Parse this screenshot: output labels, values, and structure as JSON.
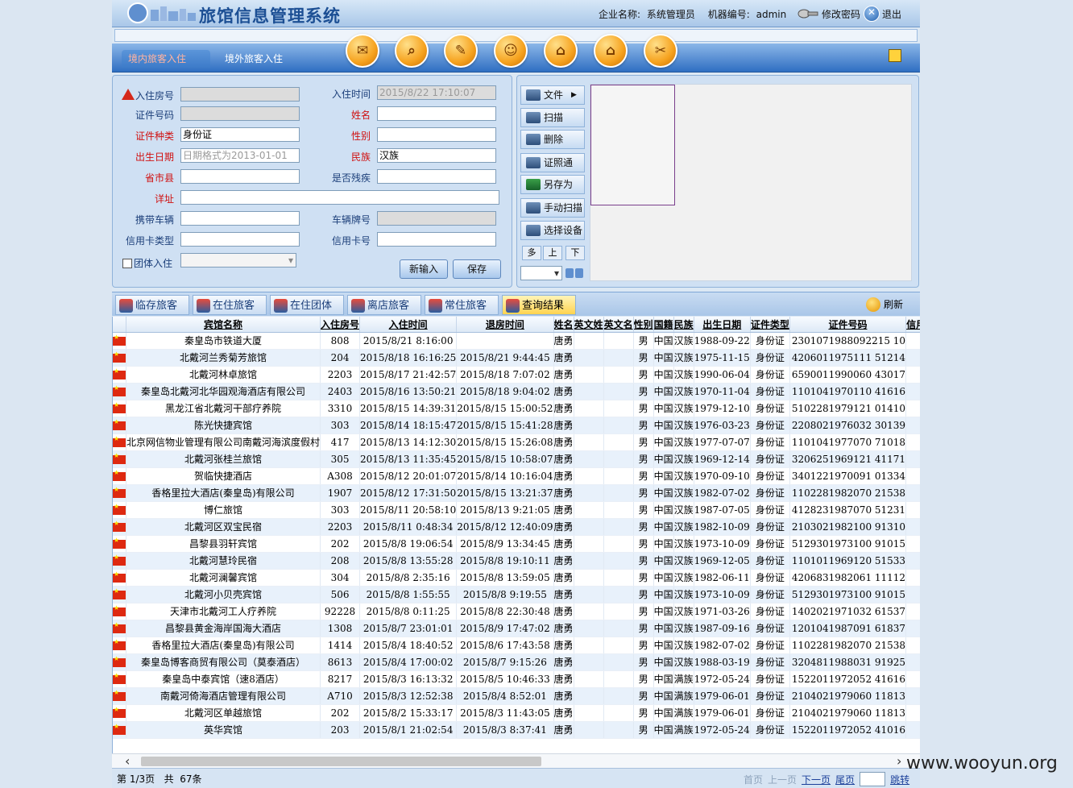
{
  "header": {
    "title": "旅馆信息管理系统",
    "company_label": "企业名称:",
    "company_value": "系统管理员",
    "machine_label": "机器编号:",
    "machine_value": "admin",
    "change_password": "修改密码",
    "logout": "退出"
  },
  "nav": {
    "tabs": [
      {
        "label": "境内旅客入住",
        "active": true
      },
      {
        "label": "境外旅客入住",
        "active": false
      }
    ],
    "icons": [
      "mail-icon",
      "search-doc-icon",
      "clean-icon",
      "user-icon",
      "home-icon",
      "house-settings-icon",
      "tools-icon"
    ]
  },
  "form": {
    "room_no": {
      "label": "入住房号",
      "value": ""
    },
    "checkin_time": {
      "label": "入住时间",
      "value": "2015/8/22 17:10:07"
    },
    "id_no": {
      "label": "证件号码",
      "value": ""
    },
    "name": {
      "label": "姓名",
      "value": ""
    },
    "id_type": {
      "label": "证件种类",
      "value": "身份证"
    },
    "gender": {
      "label": "性别",
      "value": ""
    },
    "birth": {
      "label": "出生日期",
      "placeholder": "日期格式为2013-01-01"
    },
    "ethnicity": {
      "label": "民族",
      "value": "汉族"
    },
    "province": {
      "label": "省市县",
      "value": ""
    },
    "disabled": {
      "label": "是否残疾",
      "value": ""
    },
    "address": {
      "label": "详址",
      "value": ""
    },
    "vehicle": {
      "label": "携带车辆",
      "value": ""
    },
    "plate": {
      "label": "车辆牌号",
      "value": ""
    },
    "card_type": {
      "label": "信用卡类型",
      "value": ""
    },
    "card_no": {
      "label": "信用卡号",
      "value": ""
    },
    "group": {
      "label": "团体入住"
    },
    "btn_new": "新输入",
    "btn_save": "保存"
  },
  "side": {
    "buttons": [
      "文件",
      "扫描",
      "删除",
      "证照通",
      "另存为",
      "手动扫描",
      "选择设备"
    ],
    "tabs": [
      "多",
      "上",
      "下"
    ]
  },
  "tabs": {
    "items": [
      "临存旅客",
      "在住旅客",
      "在住团体",
      "离店旅客",
      "常住旅客",
      "查询结果"
    ],
    "active": "查询结果",
    "refresh": "刷新"
  },
  "grid": {
    "columns": [
      "宾馆名称",
      "入住房号",
      "入住时间",
      "退房时间",
      "姓名",
      "英文姓",
      "英文名",
      "性别",
      "国籍",
      "民族",
      "出生日期",
      "证件类型",
      "证件号码",
      "信用卡类"
    ],
    "rows": [
      [
        "秦皇岛市铁道大厦",
        "808",
        "2015/8/21 8:16:00",
        "",
        "唐勇",
        "",
        "",
        "男",
        "中国",
        "汉族",
        "1988-09-22",
        "身份证",
        "2301071988092215 10"
      ],
      [
        "北戴河兰秀菊芳旅馆",
        "204",
        "2015/8/18 16:16:25",
        "2015/8/21 9:44:45",
        "唐勇",
        "",
        "",
        "男",
        "中国",
        "汉族",
        "1975-11-15",
        "身份证",
        "4206011975111 51214"
      ],
      [
        "北戴河林卓旅馆",
        "2203",
        "2015/8/17 21:42:57",
        "2015/8/18 7:07:02",
        "唐勇",
        "",
        "",
        "男",
        "中国",
        "汉族",
        "1990-06-04",
        "身份证",
        "6590011990060 43017"
      ],
      [
        "秦皇岛北戴河北华园观海酒店有限公司",
        "2403",
        "2015/8/16 13:50:21",
        "2015/8/18 9:04:02",
        "唐勇",
        "",
        "",
        "男",
        "中国",
        "汉族",
        "1970-11-04",
        "身份证",
        "1101041970110 41616"
      ],
      [
        "黑龙江省北戴河干部疗养院",
        "3310",
        "2015/8/15 14:39:31",
        "2015/8/15 15:00:52",
        "唐勇",
        "",
        "",
        "男",
        "中国",
        "汉族",
        "1979-12-10",
        "身份证",
        "5102281979121 01410"
      ],
      [
        "陈光快捷宾馆",
        "303",
        "2015/8/14 18:15:47",
        "2015/8/15 15:41:28",
        "唐勇",
        "",
        "",
        "男",
        "中国",
        "汉族",
        "1976-03-23",
        "身份证",
        "2208021976032 30139"
      ],
      [
        "北京网信物业管理有限公司南戴河海滨度假村",
        "417",
        "2015/8/13 14:12:30",
        "2015/8/15 15:26:08",
        "唐勇",
        "",
        "",
        "男",
        "中国",
        "汉族",
        "1977-07-07",
        "身份证",
        "1101041977070 71018"
      ],
      [
        "北戴河张桂兰旅馆",
        "305",
        "2015/8/13 11:35:45",
        "2015/8/15 10:58:07",
        "唐勇",
        "",
        "",
        "男",
        "中国",
        "汉族",
        "1969-12-14",
        "身份证",
        "3206251969121 41171"
      ],
      [
        "贺临快捷酒店",
        "A308",
        "2015/8/12 20:01:07",
        "2015/8/14 10:16:04",
        "唐勇",
        "",
        "",
        "男",
        "中国",
        "汉族",
        "1970-09-10",
        "身份证",
        "3401221970091 01334"
      ],
      [
        "香格里拉大酒店(秦皇岛)有限公司",
        "1907",
        "2015/8/12 17:31:50",
        "2015/8/15 13:21:37",
        "唐勇",
        "",
        "",
        "男",
        "中国",
        "汉族",
        "1982-07-02",
        "身份证",
        "1102281982070 21538"
      ],
      [
        "博仁旅馆",
        "303",
        "2015/8/11 20:58:10",
        "2015/8/13 9:21:05",
        "唐勇",
        "",
        "",
        "男",
        "中国",
        "汉族",
        "1987-07-05",
        "身份证",
        "4128231987070 51231"
      ],
      [
        "北戴河区双宝民宿",
        "2203",
        "2015/8/11 0:48:34",
        "2015/8/12 12:40:09",
        "唐勇",
        "",
        "",
        "男",
        "中国",
        "汉族",
        "1982-10-09",
        "身份证",
        "2103021982100 91310"
      ],
      [
        "昌黎县羽轩宾馆",
        "202",
        "2015/8/8 19:06:54",
        "2015/8/9 13:34:45",
        "唐勇",
        "",
        "",
        "男",
        "中国",
        "汉族",
        "1973-10-09",
        "身份证",
        "5129301973100 91015"
      ],
      [
        "北戴河慧玲民宿",
        "208",
        "2015/8/8 13:55:28",
        "2015/8/8 19:10:11",
        "唐勇",
        "",
        "",
        "男",
        "中国",
        "汉族",
        "1969-12-05",
        "身份证",
        "1101011969120 51533"
      ],
      [
        "北戴河澜馨宾馆",
        "304",
        "2015/8/8 2:35:16",
        "2015/8/8 13:59:05",
        "唐勇",
        "",
        "",
        "男",
        "中国",
        "汉族",
        "1982-06-11",
        "身份证",
        "4206831982061 11112"
      ],
      [
        "北戴河小贝壳宾馆",
        "506",
        "2015/8/8 1:55:55",
        "2015/8/8 9:19:55",
        "唐勇",
        "",
        "",
        "男",
        "中国",
        "汉族",
        "1973-10-09",
        "身份证",
        "5129301973100 91015"
      ],
      [
        "天津市北戴河工人疗养院",
        "92228",
        "2015/8/8 0:11:25",
        "2015/8/8 22:30:48",
        "唐勇",
        "",
        "",
        "男",
        "中国",
        "汉族",
        "1971-03-26",
        "身份证",
        "1402021971032 61537"
      ],
      [
        "昌黎县黄金海岸国海大酒店",
        "1308",
        "2015/8/7 23:01:01",
        "2015/8/9 17:47:02",
        "唐勇",
        "",
        "",
        "男",
        "中国",
        "汉族",
        "1987-09-16",
        "身份证",
        "1201041987091 61837"
      ],
      [
        "香格里拉大酒店(秦皇岛)有限公司",
        "1414",
        "2015/8/4 18:40:52",
        "2015/8/6 17:43:58",
        "唐勇",
        "",
        "",
        "男",
        "中国",
        "汉族",
        "1982-07-02",
        "身份证",
        "1102281982070 21538"
      ],
      [
        "秦皇岛博客商贸有限公司（莫泰酒店）",
        "8613",
        "2015/8/4 17:00:02",
        "2015/8/7 9:15:26",
        "唐勇",
        "",
        "",
        "男",
        "中国",
        "汉族",
        "1988-03-19",
        "身份证",
        "3204811988031 91925"
      ],
      [
        "秦皇岛中泰宾馆（速8酒店）",
        "8217",
        "2015/8/3 16:13:32",
        "2015/8/5 10:46:33",
        "唐勇",
        "",
        "",
        "男",
        "中国",
        "满族",
        "1972-05-24",
        "身份证",
        "1522011972052 41616"
      ],
      [
        "南戴河倚海酒店管理有限公司",
        "A710",
        "2015/8/3 12:52:38",
        "2015/8/4 8:52:01",
        "唐勇",
        "",
        "",
        "男",
        "中国",
        "满族",
        "1979-06-01",
        "身份证",
        "2104021979060 11813"
      ],
      [
        "北戴河区单越旅馆",
        "202",
        "2015/8/2 15:33:17",
        "2015/8/3 11:43:05",
        "唐勇",
        "",
        "",
        "男",
        "中国",
        "满族",
        "1979-06-01",
        "身份证",
        "2104021979060 11813"
      ],
      [
        "英华宾馆",
        "203",
        "2015/8/1 21:02:54",
        "2015/8/3 8:37:41",
        "唐勇",
        "",
        "",
        "男",
        "中国",
        "满族",
        "1972-05-24",
        "身份证",
        "1522011972052 41016"
      ]
    ]
  },
  "status": {
    "page_info": "第 1/3页   共  67条",
    "first": "首页",
    "prev": "上一页",
    "next": "下一页",
    "last": "尾页",
    "go": "跳转"
  },
  "watermark": "www.wooyun.org"
}
